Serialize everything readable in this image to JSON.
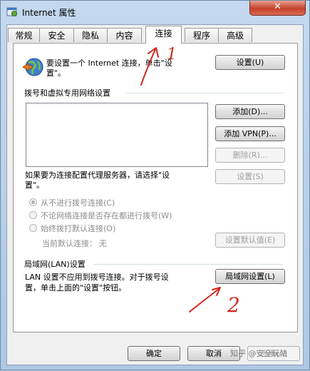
{
  "window": {
    "title": "Internet 属性",
    "close_label": "✕",
    "icon": "internet-options-icon"
  },
  "tabs": [
    {
      "label": "常规"
    },
    {
      "label": "安全"
    },
    {
      "label": "隐私"
    },
    {
      "label": "内容"
    },
    {
      "label": "连接",
      "active": true
    },
    {
      "label": "程序"
    },
    {
      "label": "高级"
    }
  ],
  "setup": {
    "text_line1": "要设置一个 Internet 连接，单击\"设",
    "text_line2": "置\"。",
    "button": "设置(U)"
  },
  "dialup": {
    "section_title": "拨号和虚拟专用网络设置",
    "add_button": "添加(D)...",
    "add_vpn_button": "添加 VPN(P)...",
    "delete_button": "删除(R)...",
    "settings_button": "设置(S)",
    "proxy_text_line1": "如果要为连接配置代理服务器，请选择\"设",
    "proxy_text_line2": "置\"。",
    "radio_options": [
      {
        "label": "从不进行拨号连接(C)",
        "checked": true
      },
      {
        "label": "不论网络连接是否存在都进行拨号(W)",
        "checked": false
      },
      {
        "label": "始终拨打默认连接(O)",
        "checked": false
      }
    ],
    "current_default_label": "当前默认连接：",
    "current_default_value": "无",
    "set_default_button": "设置默认值(E)"
  },
  "lan": {
    "section_title": "局域网(LAN)设置",
    "text_line1": "LAN 设置不应用到拨号连接。对于拨号设",
    "text_line2": "置，单击上面的\"设置\"按钮。",
    "button": "局域网设置(L)"
  },
  "footer": {
    "ok": "确定",
    "cancel": "取消",
    "apply": "应用(A)"
  },
  "annotations": {
    "mark1": "1",
    "mark2": "2",
    "color": "#d0281e"
  },
  "watermark": "知乎 @安全玩法"
}
